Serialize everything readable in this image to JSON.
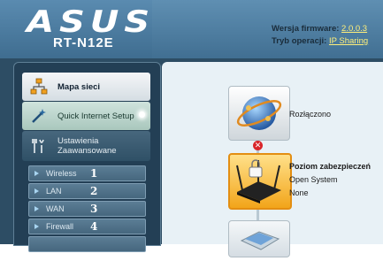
{
  "header": {
    "logo": "ASUS",
    "model": "RT-N12E",
    "firmware_label": "Wersja firmware:",
    "firmware_value": "2.0.0.3",
    "mode_label": "Tryb operacji:",
    "mode_value": "IP Sharing"
  },
  "sidebar": {
    "network_map": "Mapa sieci",
    "quick_setup": "Quick Internet Setup",
    "advanced_line1": "Ustawienia",
    "advanced_line2": "Zaawansowane",
    "submenu": [
      {
        "label": "Wireless",
        "number": "1"
      },
      {
        "label": "LAN",
        "number": "2"
      },
      {
        "label": "WAN",
        "number": "3"
      },
      {
        "label": "Firewall",
        "number": "4"
      }
    ]
  },
  "main": {
    "internet_status": "Rozłączono",
    "security_title": "Poziom zabezpieczeń",
    "security_auth": "Open System",
    "security_enc": "None"
  },
  "colors": {
    "header": "#4f80a4",
    "frame": "#2d4d64",
    "main_bg": "#e8f1f6",
    "router_tile": "#f2a51a",
    "status_error": "#d9262b"
  }
}
